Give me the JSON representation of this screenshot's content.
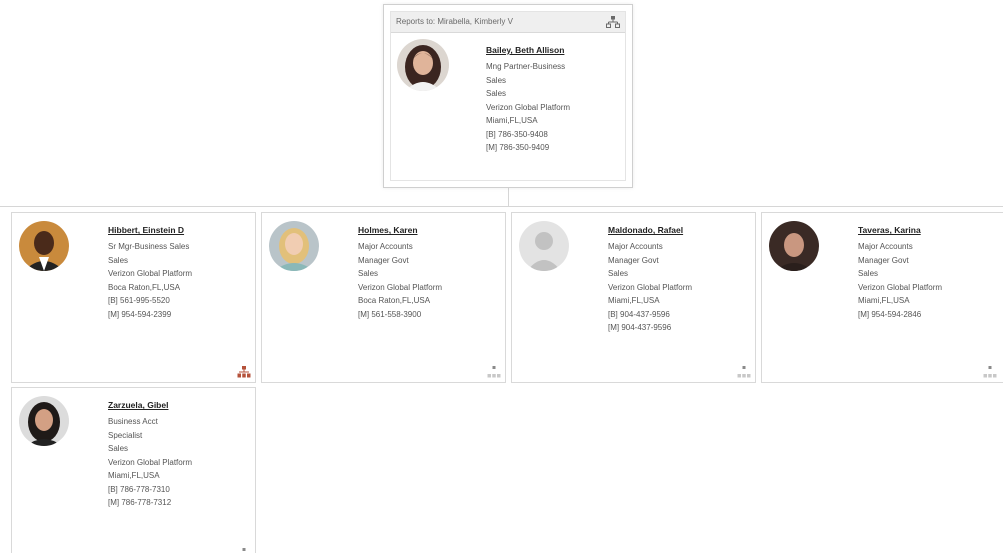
{
  "manager": {
    "reports_to": "Reports to: Mirabella, Kimberly V",
    "name": "Bailey, Beth Allison",
    "lines": [
      "Mng Partner-Business",
      "Sales",
      "Sales",
      "Verizon Global Platform",
      "Miami,FL,USA",
      "[B] 786-350-9408",
      "[M] 786-350-9409"
    ]
  },
  "reports": [
    {
      "name": "Hibbert, Einstein D",
      "lines": [
        "Sr Mgr-Business Sales",
        "Sales",
        "Verizon Global Platform",
        "Boca Raton,FL,USA",
        "[B] 561-995-5520",
        "[M] 954-594-2399"
      ],
      "has_reports": true
    },
    {
      "name": "Holmes, Karen",
      "lines": [
        "Major Accounts",
        "Manager Govt",
        "Sales",
        "Verizon Global Platform",
        "Boca Raton,FL,USA",
        "[M] 561-558-3900"
      ],
      "has_reports": false
    },
    {
      "name": "Maldonado, Rafael",
      "lines": [
        "Major Accounts",
        "Manager Govt",
        "Sales",
        "Verizon Global Platform",
        "Miami,FL,USA",
        "[B] 904-437-9596",
        "[M] 904-437-9596"
      ],
      "has_reports": false
    },
    {
      "name": "Taveras, Karina",
      "lines": [
        "Major Accounts",
        "Manager Govt",
        "Sales",
        "Verizon Global Platform",
        "Miami,FL,USA",
        "[M] 954-594-2846"
      ],
      "has_reports": false
    },
    {
      "name": "Zarzuela, Gibel",
      "lines": [
        "Business Acct",
        "Specialist",
        "Sales",
        "Verizon Global Platform",
        "Miami,FL,USA",
        "[B] 786-778-7310",
        "[M] 786-778-7312"
      ],
      "has_reports": false
    }
  ],
  "colors": {
    "org_icon_active": "#b5523b",
    "org_icon_inactive": "#b8b8b8"
  }
}
